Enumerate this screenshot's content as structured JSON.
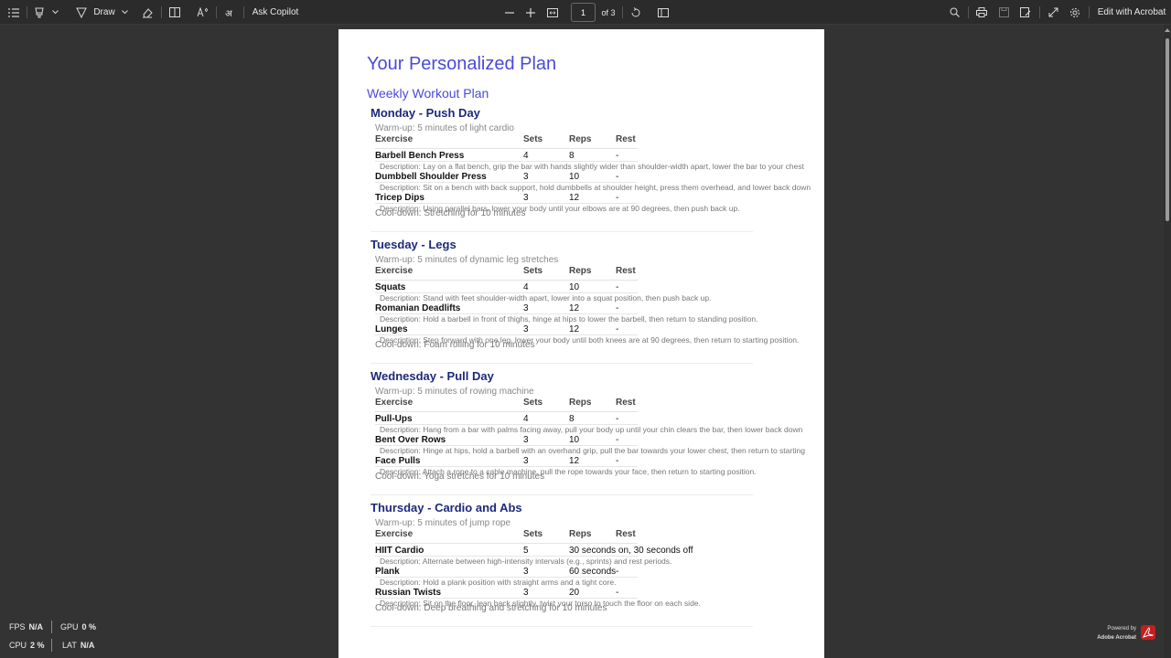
{
  "toolbar": {
    "draw_label": "Draw",
    "ask_copilot_label": "Ask Copilot",
    "page_current": "1",
    "page_total": "of 3",
    "edit_label": "Edit with Acrobat"
  },
  "document": {
    "title": "Your Personalized Plan",
    "subtitle": "Weekly Workout Plan",
    "headers": {
      "exercise": "Exercise",
      "sets": "Sets",
      "reps": "Reps",
      "rest": "Rest"
    },
    "days": [
      {
        "title": "Monday - Push Day",
        "warmup": "Warm-up: 5 minutes of light cardio",
        "exercises": [
          {
            "name": "Barbell Bench Press",
            "sets": "4",
            "reps": "8",
            "rest": "-",
            "description": "Description: Lay on a flat bench, grip the bar with hands slightly wider than shoulder-width apart, lower the bar to your chest"
          },
          {
            "name": "Dumbbell Shoulder Press",
            "sets": "3",
            "reps": "10",
            "rest": "-",
            "description": "Description: Sit on a bench with back support, hold dumbbells at shoulder height, press them overhead, and lower back down"
          },
          {
            "name": "Tricep Dips",
            "sets": "3",
            "reps": "12",
            "rest": "-",
            "description": "Description: Using parallel bars, lower your body until your elbows are at 90 degrees, then push back up."
          }
        ],
        "cooldown": "Cool-down: Stretching for 10 minutes"
      },
      {
        "title": "Tuesday - Legs",
        "warmup": "Warm-up: 5 minutes of dynamic leg stretches",
        "exercises": [
          {
            "name": "Squats",
            "sets": "4",
            "reps": "10",
            "rest": "-",
            "description": "Description: Stand with feet shoulder-width apart, lower into a squat position, then push back up."
          },
          {
            "name": "Romanian Deadlifts",
            "sets": "3",
            "reps": "12",
            "rest": "-",
            "description": "Description: Hold a barbell in front of thighs, hinge at hips to lower the barbell, then return to standing position."
          },
          {
            "name": "Lunges",
            "sets": "3",
            "reps": "12",
            "rest": "-",
            "description": "Description: Step forward with one leg, lower your body until both knees are at 90 degrees, then return to starting position."
          }
        ],
        "cooldown": "Cool-down: Foam rolling for 10 minutes"
      },
      {
        "title": "Wednesday - Pull Day",
        "warmup": "Warm-up: 5 minutes of rowing machine",
        "exercises": [
          {
            "name": "Pull-Ups",
            "sets": "4",
            "reps": "8",
            "rest": "-",
            "description": "Description: Hang from a bar with palms facing away, pull your body up until your chin clears the bar, then lower back down"
          },
          {
            "name": "Bent Over Rows",
            "sets": "3",
            "reps": "10",
            "rest": "-",
            "description": "Description: Hinge at hips, hold a barbell with an overhand grip, pull the bar towards your lower chest, then return to starting"
          },
          {
            "name": "Face Pulls",
            "sets": "3",
            "reps": "12",
            "rest": "-",
            "description": "Description: Attach a rope to a cable machine, pull the rope towards your face, then return to starting position."
          }
        ],
        "cooldown": "Cool-down: Yoga stretches for 10 minutes"
      },
      {
        "title": "Thursday - Cardio and Abs",
        "warmup": "Warm-up: 5 minutes of jump rope",
        "exercises": [
          {
            "name": "HIIT Cardio",
            "sets": "5",
            "reps": "30 seconds on, 30 seconds off",
            "rest": "",
            "description": "Description: Alternate between high-intensity intervals (e.g., sprints) and rest periods."
          },
          {
            "name": "Plank",
            "sets": "3",
            "reps": "60 seconds",
            "rest": "-",
            "description": "Description: Hold a plank position with straight arms and a tight core."
          },
          {
            "name": "Russian Twists",
            "sets": "3",
            "reps": "20",
            "rest": "-",
            "description": "Description: Sit on the floor, lean back slightly, twist your torso to touch the floor on each side."
          }
        ],
        "cooldown": "Cool-down: Deep breathing and stretching for 10 minutes"
      }
    ]
  },
  "perf": {
    "fps_label": "FPS",
    "fps_value": "N/A",
    "gpu_label": "GPU",
    "gpu_value": "0 %",
    "cpu_label": "CPU",
    "cpu_value": "2 %",
    "lat_label": "LAT",
    "lat_value": "N/A"
  },
  "branding": {
    "powered_by": "Powered by",
    "product": "Adobe Acrobat"
  },
  "icons": {
    "toc": "list-icon",
    "highlight": "highlighter-icon",
    "draw": "pen-icon",
    "erase": "eraser-icon",
    "text": "text-box-icon",
    "read_aloud": "read-aloud-icon",
    "translate": "translate-icon",
    "zoom_out": "minus-icon",
    "zoom_in": "plus-icon",
    "fit": "fit-page-icon",
    "rotate": "rotate-icon",
    "page_view": "page-view-icon",
    "search": "search-icon",
    "print": "print-icon",
    "save": "save-icon",
    "save_as": "save-as-icon",
    "expand": "expand-icon",
    "settings": "gear-icon"
  },
  "colors": {
    "title": "#4a4adb",
    "day_title": "#1c2a7a",
    "toolbar_bg": "#2b2b2b",
    "viewer_bg": "#333333",
    "acrobat_red": "#c41e1e"
  }
}
